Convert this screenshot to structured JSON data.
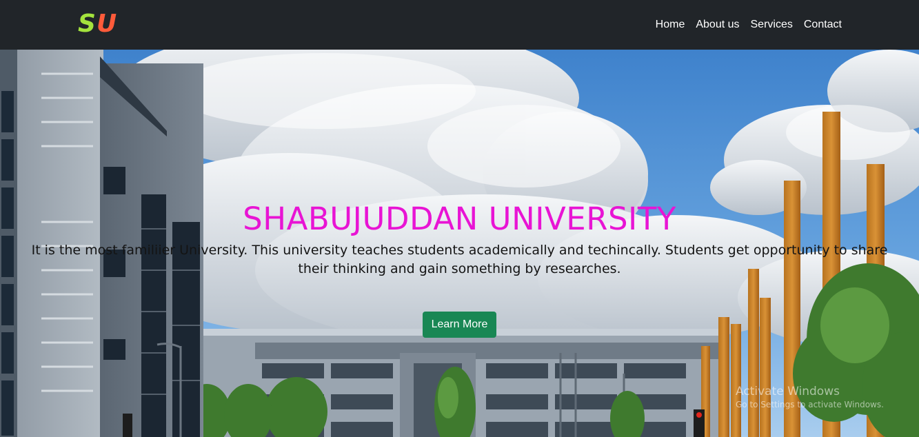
{
  "navbar": {
    "logo_first": "S",
    "logo_second": "U",
    "links": [
      "Home",
      "About us",
      "Services",
      "Contact"
    ]
  },
  "hero": {
    "title": "SHABUJUDDAN UNIVERSITY",
    "description": "It is the most familiier University. This university teaches students academically and techincally. Students get opportunity to share their thinking and gain something by researches.",
    "button_label": "Learn More",
    "background": "university-campus-photo"
  },
  "watermark": {
    "line1": "Activate Windows",
    "line2": "Go to Settings to activate Windows."
  },
  "colors": {
    "navbar_bg": "#212529",
    "logo_s": "#a4e33d",
    "logo_u": "#ff5b3a",
    "title": "#e814d4",
    "button_bg": "#198754"
  }
}
